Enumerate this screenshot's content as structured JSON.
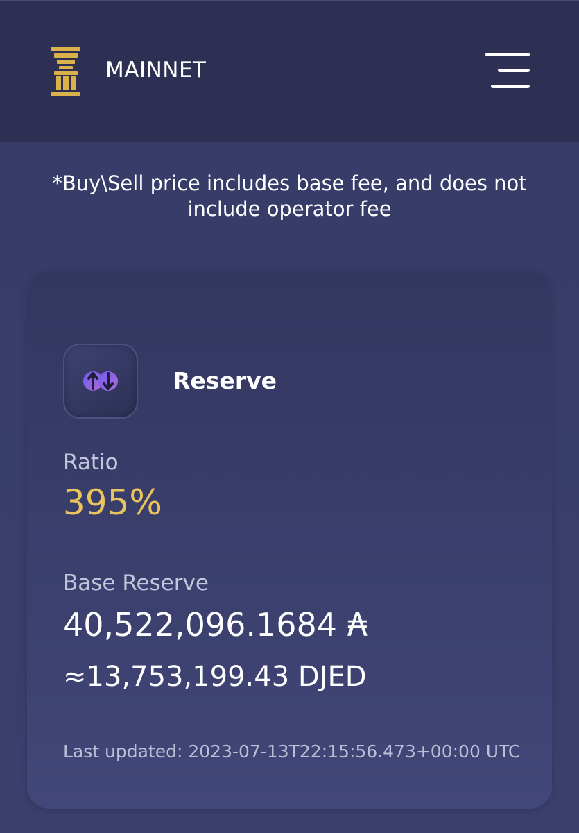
{
  "header": {
    "network": "MAINNET",
    "logo_icon": "pillar-logo-icon",
    "menu_icon": "hamburger-menu-icon"
  },
  "fee_note": "*Buy\\Sell price includes base fee, and does not include operator fee",
  "reserve_card": {
    "icon": "reserve-cycle-icon",
    "title": "Reserve",
    "ratio_label": "Ratio",
    "ratio_value": "395%",
    "base_reserve_label": "Base Reserve",
    "base_reserve_value": "40,522,096.1684 ₳",
    "djed_equivalent": "≈13,753,199.43 DJED",
    "last_updated": "Last updated: 2023-07-13T22:15:56.473+00:00 UTC"
  },
  "colors": {
    "accent_gold": "#e8c35e",
    "header_bg": "#2d3052",
    "icon_purple": "#8b5cf6"
  }
}
